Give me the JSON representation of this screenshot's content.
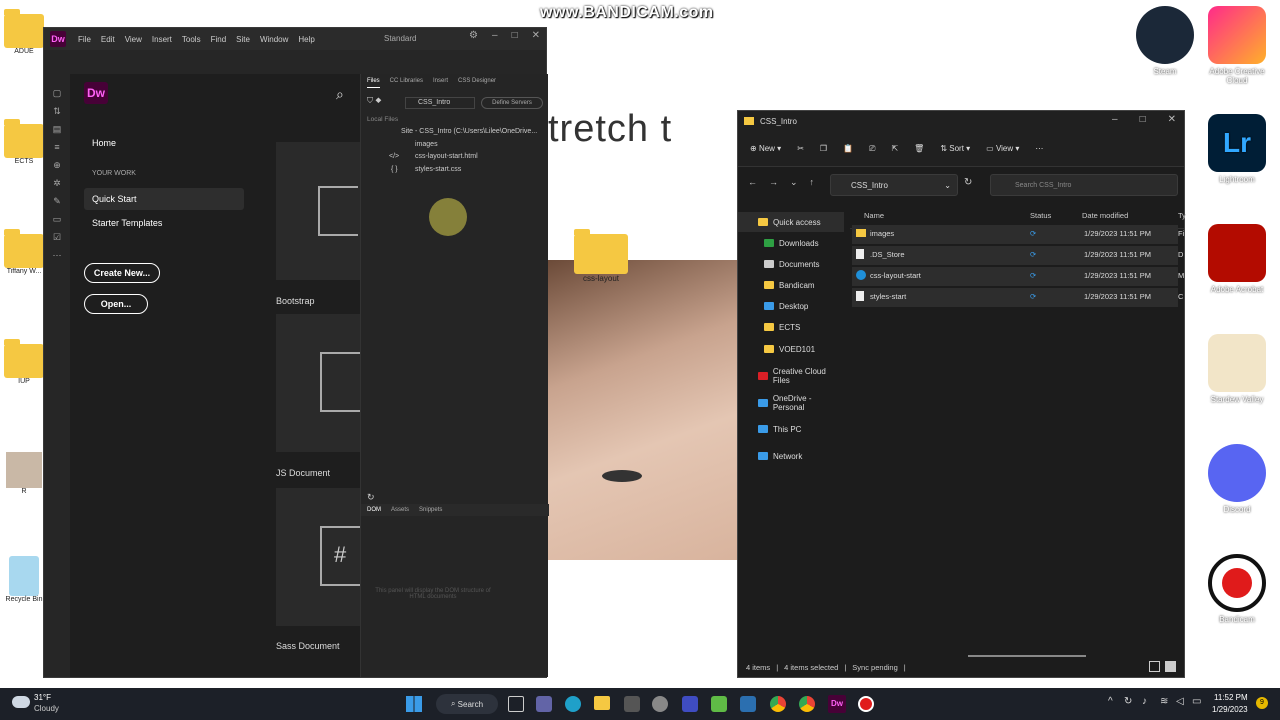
{
  "watermark": "www.BANDICAM.com",
  "background_text": "tretch t",
  "desktop": {
    "left_icons": [
      {
        "label": "ADUE"
      },
      {
        "label": "ECTS"
      },
      {
        "label": "Tiffany W..."
      },
      {
        "label": "IUP"
      },
      {
        "label": "R"
      },
      {
        "label": "Recycle Bin"
      }
    ],
    "right_icons": [
      {
        "label": "Steam",
        "color": "#1b2838"
      },
      {
        "label": "Adobe Creative Cloud",
        "color": "#da1f26"
      },
      {
        "label": "Lightroom",
        "color": "#001e36"
      },
      {
        "label": "Adobe Acrobat",
        "color": "#b30b00"
      },
      {
        "label": "Stardew Valley",
        "color": "#f2e5c8"
      },
      {
        "label": "Discord",
        "color": "#5865f2"
      },
      {
        "label": "Bandicam",
        "color": "#ffffff"
      }
    ],
    "folder_label": "css-layout"
  },
  "dw": {
    "logo": "Dw",
    "menu": [
      "File",
      "Edit",
      "View",
      "Insert",
      "Tools",
      "Find",
      "Site",
      "Window",
      "Help"
    ],
    "workspace": "Standard",
    "nav": {
      "home": "Home",
      "section": "YOUR WORK",
      "quick_start": "Quick Start",
      "starter_templates": "Starter Templates",
      "create_new": "Create New...",
      "open": "Open..."
    },
    "cards": [
      "Bootstrap",
      "JS Document",
      "Sass Document"
    ],
    "panel": {
      "tabs": [
        "Files",
        "CC Libraries",
        "Insert",
        "CSS Designer"
      ],
      "site_select": "CSS_Intro",
      "define_servers": "Define Servers",
      "local_files": "Local Files",
      "site_root": "Site - CSS_Intro (C:\\Users\\Lilee\\OneDrive...",
      "files": [
        "images",
        "css-layout-start.html",
        "styles-start.css"
      ],
      "bottom_tabs": [
        "DOM",
        "Assets",
        "Snippets"
      ],
      "dom_hint": "This panel will display the DOM structure of HTML documents"
    }
  },
  "explorer": {
    "title": "CSS_Intro",
    "toolbar": {
      "new": "New",
      "sort": "Sort",
      "view": "View"
    },
    "address": "CSS_Intro",
    "search_placeholder": "Search CSS_Intro",
    "nav": [
      {
        "label": "Quick access",
        "color": "#f5c842"
      },
      {
        "label": "Downloads",
        "color": "#2ea043"
      },
      {
        "label": "Documents",
        "color": "#cccccc"
      },
      {
        "label": "Bandicam",
        "color": "#f5c842"
      },
      {
        "label": "Desktop",
        "color": "#3a9be8"
      },
      {
        "label": "ECTS",
        "color": "#f5c842"
      },
      {
        "label": "VOED101",
        "color": "#f5c842"
      },
      {
        "label": "Creative Cloud Files",
        "color": "#da1f26"
      },
      {
        "label": "OneDrive - Personal",
        "color": "#3a9be8"
      },
      {
        "label": "This PC",
        "color": "#3a9be8"
      },
      {
        "label": "Network",
        "color": "#3a9be8"
      }
    ],
    "columns": [
      "Name",
      "Status",
      "Date modified",
      "Ty"
    ],
    "files": [
      {
        "name": "images",
        "date": "1/29/2023 11:51 PM",
        "type": "Fi"
      },
      {
        "name": ".DS_Store",
        "date": "1/29/2023 11:51 PM",
        "type": "D"
      },
      {
        "name": "css-layout-start",
        "date": "1/29/2023 11:51 PM",
        "type": "M"
      },
      {
        "name": "styles-start",
        "date": "1/29/2023 11:51 PM",
        "type": "C"
      }
    ],
    "status": {
      "items": "4 items",
      "selected": "4 items selected",
      "sync": "Sync pending"
    }
  },
  "taskbar": {
    "weather_temp": "31°F",
    "weather_desc": "Cloudy",
    "search": "Search",
    "time": "11:52 PM",
    "date": "1/29/2023",
    "notifications": "9"
  }
}
